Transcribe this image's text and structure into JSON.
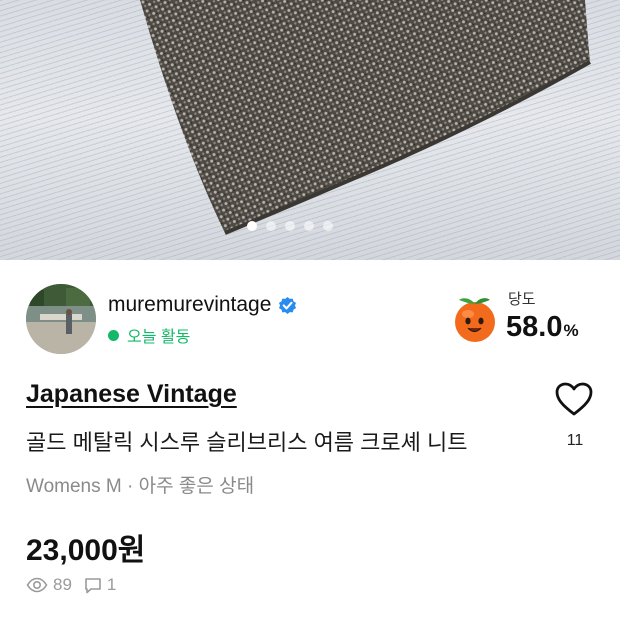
{
  "carousel": {
    "dot_count": 5,
    "active_index": 0
  },
  "seller": {
    "name": "muremurevintage",
    "verified": true,
    "activity_status": "오늘 활동",
    "manner_label": "당도",
    "manner_value": "58.0",
    "manner_unit": "%"
  },
  "product": {
    "brand": "Japanese Vintage",
    "title": "골드 메탈릭 시스루 슬리브리스 여름 크로셰 니트",
    "meta": "Womens M · 아주 좋은 상태",
    "price": "23,000원"
  },
  "like": {
    "count": "11"
  },
  "stats": {
    "views": "89",
    "comments": "1"
  },
  "colors": {
    "accent_green": "#14b86a",
    "muted_text": "#8a8a8a",
    "persimmon": "#f26a1b"
  },
  "icons": [
    "verified-badge-icon",
    "persimmon-icon",
    "heart-icon",
    "eye-icon",
    "comment-icon"
  ]
}
